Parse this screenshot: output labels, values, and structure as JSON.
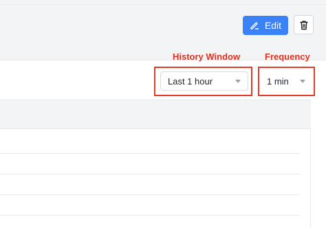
{
  "toolbar": {
    "edit_label": "Edit",
    "edit_icon": "pencil-icon",
    "delete_icon": "trash-icon"
  },
  "annotations": {
    "history_window": "History Window",
    "frequency": "Frequency"
  },
  "controls": {
    "history_window_value": "Last 1 hour",
    "frequency_value": "1 min"
  },
  "colors": {
    "primary_button": "#3b82f6",
    "annotation_red": "#e0301e"
  }
}
